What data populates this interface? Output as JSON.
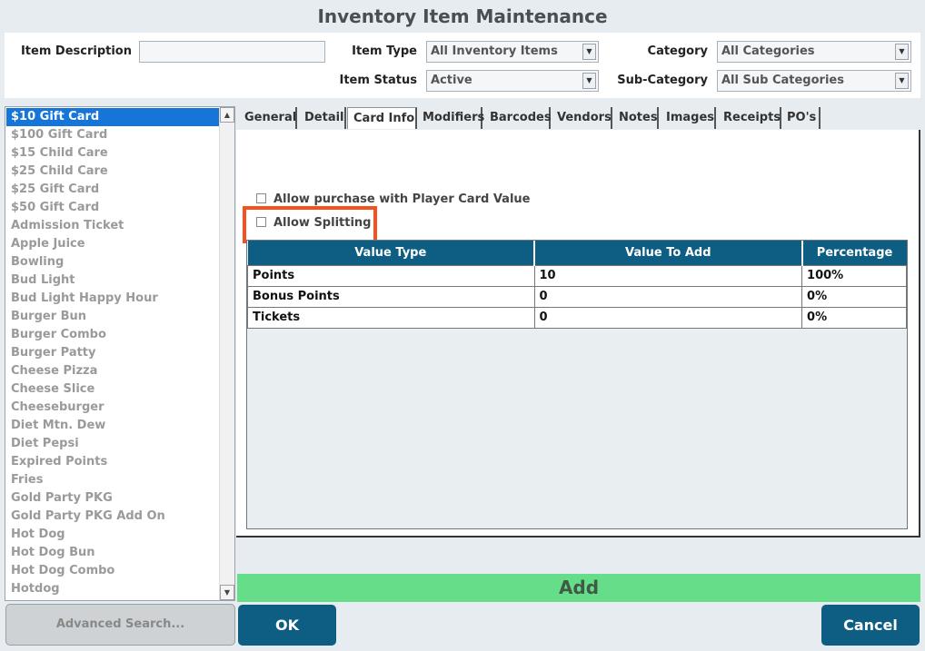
{
  "window": {
    "title": "Inventory Item Maintenance"
  },
  "filters": {
    "item_description": {
      "label": "Item Description",
      "value": ""
    },
    "item_type": {
      "label": "Item Type",
      "value": "All Inventory Items"
    },
    "item_status": {
      "label": "Item Status",
      "value": "Active"
    },
    "category": {
      "label": "Category",
      "value": "All Categories"
    },
    "sub_category": {
      "label": "Sub-Category",
      "value": "All Sub Categories"
    }
  },
  "items": [
    "$10 Gift Card",
    "$100 Gift Card",
    "$15 Child Care",
    "$25 Child Care",
    "$25 Gift Card",
    "$50 Gift Card",
    "Admission Ticket",
    "Apple Juice",
    "Bowling",
    "Bud Light",
    "Bud Light Happy Hour",
    "Burger Bun",
    "Burger Combo",
    "Burger Patty",
    "Cheese Pizza",
    "Cheese Slice",
    "Cheeseburger",
    "Diet Mtn. Dew",
    "Diet Pepsi",
    "Expired Points",
    "Fries",
    "Gold Party PKG",
    "Gold Party PKG Add On",
    "Hot Dog",
    "Hot Dog Bun",
    "Hot Dog Combo",
    "Hotdog"
  ],
  "selected_item": "$10 Gift Card",
  "tabs": [
    "General",
    "Detail",
    "Card Info",
    "Modifiers",
    "Barcodes",
    "Vendors",
    "Notes",
    "Images",
    "Receipts",
    "PO's"
  ],
  "active_tab": "Card Info",
  "card_info": {
    "allow_purchase_label": "Allow purchase with Player Card Value",
    "allow_splitting_label": "Allow Splitting",
    "columns": [
      "Value Type",
      "Value To Add",
      "Percentage"
    ],
    "rows": [
      {
        "type": "Points",
        "value": "10",
        "percentage": "100%"
      },
      {
        "type": "Bonus Points",
        "value": "0",
        "percentage": "0%"
      },
      {
        "type": "Tickets",
        "value": "0",
        "percentage": "0%"
      }
    ]
  },
  "buttons": {
    "add": "Add",
    "advanced_search": "Advanced Search...",
    "ok": "OK",
    "cancel": "Cancel"
  },
  "colors": {
    "accent": "#0e5e84",
    "selected": "#1675d8",
    "add_bar": "#66dd88",
    "highlight": "#f4511e"
  }
}
